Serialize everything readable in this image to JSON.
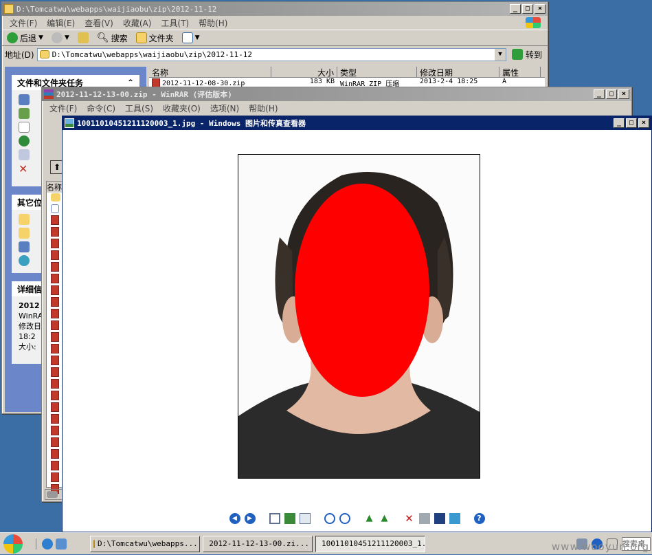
{
  "explorer": {
    "title": "D:\\Tomcatwu\\webapps\\waijiaobu\\zip\\2012-11-12",
    "menu": [
      "文件(F)",
      "编辑(E)",
      "查看(V)",
      "收藏(A)",
      "工具(T)",
      "帮助(H)"
    ],
    "toolbar": {
      "back": "后退",
      "search": "搜索",
      "folders": "文件夹"
    },
    "address_label": "地址(D)",
    "address_value": "D:\\Tomcatwu\\webapps\\waijiaobu\\zip\\2012-11-12",
    "go_label": "转到",
    "columns": [
      "名称",
      "大小",
      "类型",
      "修改日期",
      "属性"
    ],
    "row": {
      "name": "2012-11-12-08-30.zip",
      "size": "183 KB",
      "type": "WinRAR ZIP 压缩",
      "date": "2013-2-4 18:25",
      "attr": "A"
    },
    "taskpane": {
      "section1": "文件和文件夹任务",
      "section2": "其它位",
      "section3": "详细信",
      "detail_name": "2012",
      "detail_type": "WinRA",
      "detail_mod": "修改日",
      "detail_time": "18:2",
      "detail_size": "大小:"
    }
  },
  "winrar": {
    "title": "2012-11-12-13-00.zip - WinRAR (评估版本)",
    "menu": [
      "文件(F)",
      "命令(C)",
      "工具(S)",
      "收藏夹(O)",
      "选项(N)",
      "帮助(H)"
    ],
    "col_name": "名称"
  },
  "viewer": {
    "title": "10011010451211120003_1.jpg - Windows 图片和传真查看器"
  },
  "taskbar": {
    "items": [
      "D:\\Tomcatwu\\webapps...",
      "2012-11-12-13-00.zi...",
      "10011010451211120003_1.jpg..."
    ],
    "search": "搜索桌"
  },
  "watermark": "www.wooyun.org",
  "colors": {
    "face_mask": "#ff0000",
    "title_active": "#0a246a",
    "desktop": "#3a6ea5"
  }
}
